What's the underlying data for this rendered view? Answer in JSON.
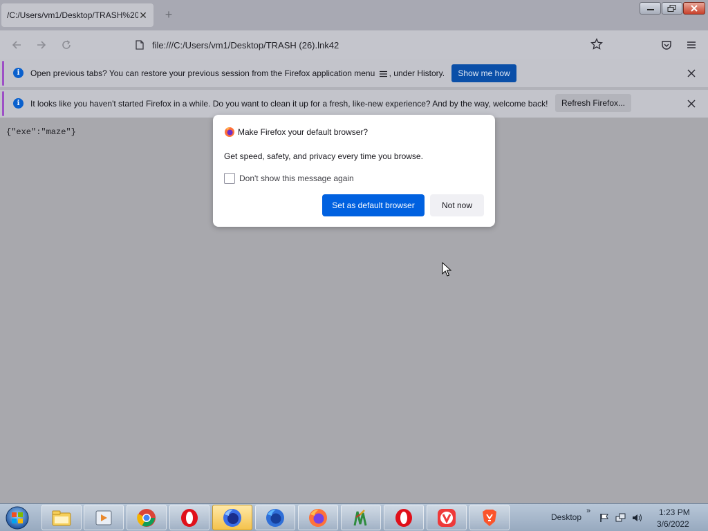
{
  "tab": {
    "title": "/C:/Users/vm1/Desktop/TRASH%20(",
    "close": "✕"
  },
  "newtab": {
    "label": "+"
  },
  "url": {
    "text": "file:///C:/Users/vm1/Desktop/TRASH (26).lnk42"
  },
  "notifications": [
    {
      "text_before": "Open previous tabs? You can restore your previous session from the Firefox application menu",
      "text_after": ", under History.",
      "button": "Show me how"
    },
    {
      "text": "It looks like you haven't started Firefox in a while. Do you want to clean it up for a fresh, like-new experience? And by the way, welcome back!",
      "button": "Refresh Firefox..."
    }
  ],
  "content": {
    "json_text": "{\"exe\":\"maze\"}"
  },
  "modal": {
    "title": "Make Firefox your default browser?",
    "body": "Get speed, safety, and privacy every time you browse.",
    "checkbox_label": "Don't show this message again",
    "checkbox_checked": false,
    "primary_button": "Set as default browser",
    "secondary_button": "Not now"
  },
  "taskbar": {
    "items": [
      "file-explorer-icon",
      "media-player-icon",
      "chrome-icon",
      "opera-icon",
      "firefox-nightly-icon",
      "firefox-developer-icon",
      "firefox-icon",
      "spirit-app-icon",
      "opera-icon",
      "vivaldi-icon",
      "brave-icon"
    ],
    "desktop_label": "Desktop",
    "chevron": "»",
    "time": "1:23 PM",
    "date": "3/6/2022"
  },
  "colors": {
    "accent": "#0061e0",
    "info": "#0a60cd",
    "notification_bar": "#c3c4cb",
    "page_overlay": "#a8a8ad"
  }
}
